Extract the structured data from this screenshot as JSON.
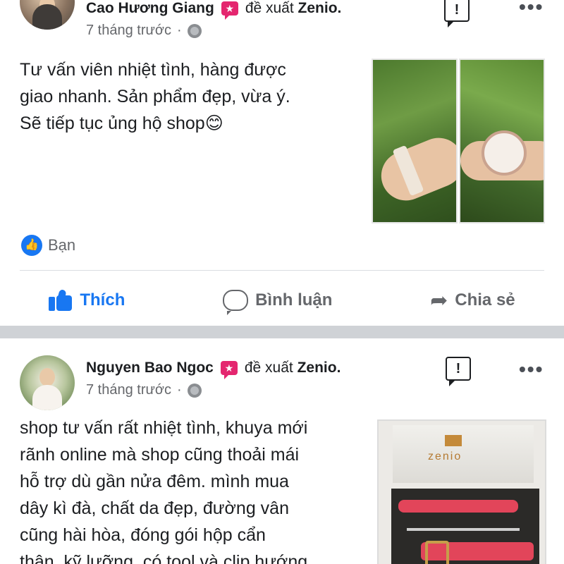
{
  "posts": [
    {
      "author": "Cao Hương Giang",
      "recommend_text": "đề xuất",
      "page_name": "Zenio.",
      "time": "7 tháng trước",
      "separator": "·",
      "text": [
        "Tư vấn viên nhiệt tình, hàng được",
        "giao nhanh. Sản phẩm đẹp, vừa ý.",
        "Sẽ tiếp tục ủng hộ shop😊"
      ],
      "reactions_label": "Bạn",
      "actions": {
        "like": "Thích",
        "comment": "Bình luận",
        "share": "Chia sẻ"
      }
    },
    {
      "author": "Nguyen Bao Ngoc",
      "recommend_text": "đề xuất",
      "page_name": "Zenio.",
      "time": "7 tháng trước",
      "separator": "·",
      "text": [
        "shop tư vấn rất nhiệt tình, khuya mới",
        "rãnh online mà shop cũng thoải mái",
        "hỗ trợ dù gần nửa đêm. mình mua",
        "dây kì đà, chất da đẹp, đường vân",
        "cũng hài hòa, đóng gói hộp cẩn",
        "thận, kỹ lưỡng, có tool và clip hướng"
      ]
    }
  ],
  "photo_brand": "zenio",
  "icons": {
    "report": "report-icon",
    "more": "more-icon",
    "globe": "globe-icon",
    "like": "like-icon",
    "comment": "comment-icon",
    "share": "share-icon",
    "recommend": "recommend-icon"
  },
  "colors": {
    "accent": "#1877f2",
    "recommend": "#e4266f",
    "secondary_text": "#65676b",
    "divider": "#cfd2d6"
  }
}
